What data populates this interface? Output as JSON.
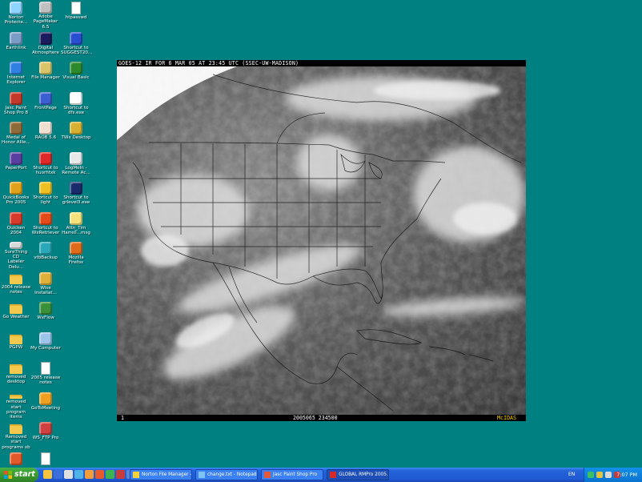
{
  "desktop": {
    "columns": [
      [
        {
          "label": "Norton\nProtecte...",
          "icon": "recycle-bin-icon",
          "color": "#8fd3ff"
        },
        {
          "label": "Earthlink",
          "icon": "earthlink-icon",
          "color": "#7a9cc6"
        },
        {
          "label": "Internet\nExplorer",
          "icon": "internet-explorer-icon",
          "color": "#2f80e0"
        },
        {
          "label": "Jasc Paint\nShop Pro 8",
          "icon": "paint-shop-pro-icon",
          "color": "#c0392b"
        },
        {
          "label": "Medal of\nHonor Allie...",
          "icon": "medal-of-honor-icon",
          "color": "#8e6c3a"
        },
        {
          "label": "PaperPort",
          "icon": "paperport-icon",
          "color": "#5a3fa0"
        },
        {
          "label": "QuickBooks\nPro 2005",
          "icon": "quickbooks-icon",
          "color": "#e0a21a"
        },
        {
          "label": "Quicken 2004",
          "icon": "quicken-icon",
          "color": "#d63a2a"
        },
        {
          "label": "SureThing CD\nLabeler Delu...",
          "icon": "surething-cd-icon",
          "color": "#d8d8d8"
        },
        {
          "label": "2004 release\nnotes",
          "icon": "folder-icon",
          "color": "#f2c94c"
        },
        {
          "label": "Go Weather",
          "icon": "folder-icon",
          "color": "#f2c94c"
        },
        {
          "label": "PGPW",
          "icon": "folder-icon",
          "color": "#f2c94c"
        },
        {
          "label": "removed\ndesktop",
          "icon": "folder-icon",
          "color": "#f2c94c"
        },
        {
          "label": "removed start\nprogram items",
          "icon": "folder-icon",
          "color": "#f2c94c"
        },
        {
          "label": "Removed start\nprograms xb",
          "icon": "folder-icon",
          "color": "#f2c94c"
        },
        {
          "label": "",
          "icon": "program-icon",
          "color": "#e05a2b"
        }
      ],
      [
        {
          "label": "Adobe\nPageMaker 6.5",
          "icon": "pagemaker-icon",
          "color": "#c0c0c0"
        },
        {
          "label": "Digital\nAtmosphere",
          "icon": "digital-atmosphere-icon",
          "color": "#1b1b5e"
        },
        {
          "label": "File Manager",
          "icon": "file-manager-icon",
          "color": "#d9c46a"
        },
        {
          "label": "FrontPage",
          "icon": "frontpage-icon",
          "color": "#3b5fd0"
        },
        {
          "label": "RAOB 5.6",
          "icon": "raob-icon",
          "color": "#f0e0d0"
        },
        {
          "label": "Shortcut to\nhuorhtxk",
          "icon": "shortcut-icon",
          "color": "#e02828"
        },
        {
          "label": "Shortcut to\nlight",
          "icon": "shortcut-icon",
          "color": "#f0c020"
        },
        {
          "label": "Shortcut to\nWxRetriever",
          "icon": "shortcut-icon",
          "color": "#e64a19"
        },
        {
          "label": "vtbBackup",
          "icon": "backup-icon",
          "color": "#2aa7b8"
        },
        {
          "label": "Wise\nInstallat...",
          "icon": "wise-installer-icon",
          "color": "#e0b03a"
        },
        {
          "label": "WxFlow",
          "icon": "wxflow-icon",
          "color": "#3a8f3a"
        },
        {
          "label": "My Computer",
          "icon": "my-computer-icon",
          "color": "#9cc3e8"
        },
        {
          "label": "2005 release\nnotes",
          "icon": "document-icon",
          "color": "#ffffff"
        },
        {
          "label": "GoToMeeting",
          "icon": "gotomeeting-icon",
          "color": "#f0a020"
        },
        {
          "label": "WS_FTP Pro",
          "icon": "ws-ftp-icon",
          "color": "#d04040"
        },
        {
          "label": "",
          "icon": "document-icon",
          "color": "#ffffff"
        }
      ],
      [
        {
          "label": "htpasswd",
          "icon": "document-icon",
          "color": "#ffffff"
        },
        {
          "label": "Shortcut to\nSUGGEST20...",
          "icon": "shortcut-icon",
          "color": "#2a4ed0"
        },
        {
          "label": "Visual Basic",
          "icon": "visual-basic-icon",
          "color": "#2c8a2c"
        },
        {
          "label": "Shortcut to\ndfs.exe",
          "icon": "shortcut-icon",
          "color": "#ffffff"
        },
        {
          "label": "TWx Desktop",
          "icon": "twx-desktop-icon",
          "color": "#d8b030"
        },
        {
          "label": "LogMeIn -\nRemote Ac...",
          "icon": "logmein-icon",
          "color": "#e8e8e8"
        },
        {
          "label": "Shortcut to\ngrlevel3.exe",
          "icon": "shortcut-icon",
          "color": "#1a2a6a"
        },
        {
          "label": "Attn_Tim\nHarrell...msg",
          "icon": "message-icon",
          "color": "#f6e27a"
        },
        {
          "label": "Mozilla Firefox",
          "icon": "firefox-icon",
          "color": "#e06b1a"
        }
      ]
    ]
  },
  "satellite": {
    "header": "GOES-12 IR FOR 6 MAR 05 AT 23:45 UTC (SSEC-UW-MADISON)",
    "footer_left": "1",
    "footer_center": "2005065 234500",
    "footer_right": "McIDAS"
  },
  "taskbar": {
    "start_label": "start",
    "quick_launch": [
      {
        "icon": "quick-launch-1-icon",
        "color": "#f5c542"
      },
      {
        "icon": "quick-launch-2-icon",
        "color": "#3b6fd9"
      },
      {
        "icon": "quick-launch-3-icon",
        "color": "#e0e0e0"
      },
      {
        "icon": "quick-launch-4-icon",
        "color": "#4fb3e8"
      },
      {
        "icon": "quick-launch-5-icon",
        "color": "#f29d38"
      },
      {
        "icon": "quick-launch-6-icon",
        "color": "#e85a2a"
      },
      {
        "icon": "quick-launch-7-icon",
        "color": "#3fb34f"
      },
      {
        "icon": "quick-launch-8-icon",
        "color": "#c93c3c"
      },
      {
        "icon": "quick-launch-9-icon",
        "color": "#5a8ad6"
      }
    ],
    "tasks": [
      {
        "label": "Norton File Manager - ...",
        "icon": "norton-icon",
        "color": "#f5d33b"
      },
      {
        "label": "change.txt - Notepad",
        "icon": "notepad-icon",
        "color": "#7ec3f0"
      },
      {
        "label": "Jasc Paint Shop Pro",
        "icon": "paint-shop-pro-icon",
        "color": "#e25a3a"
      },
      {
        "label": "GLOBAL RMPro 2005...",
        "icon": "global-rmpro-icon",
        "color": "#d62a2a"
      }
    ],
    "language": "EN",
    "clock": "7:07 PM"
  }
}
